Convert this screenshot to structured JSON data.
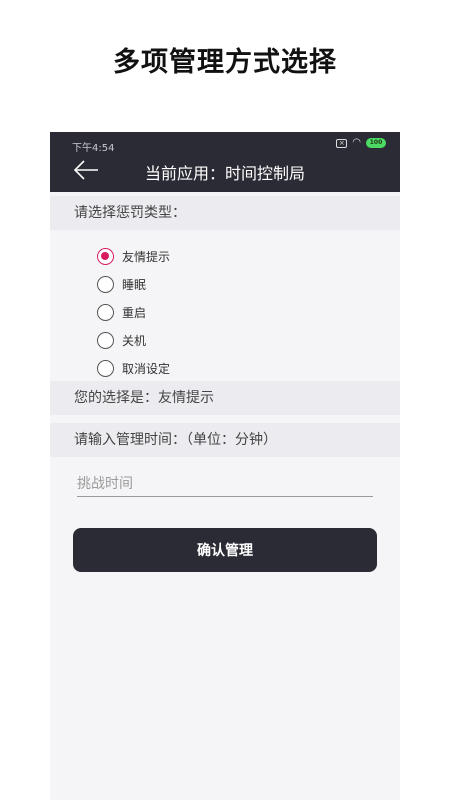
{
  "banner": {
    "title": "多项管理方式选择"
  },
  "status_bar": {
    "time": "下午4:54",
    "sim_icon": "sim-off-icon",
    "wifi_icon": "wifi-icon",
    "battery": "100"
  },
  "appbar": {
    "back_icon": "arrow-left-icon",
    "title": "当前应用：时间控制局"
  },
  "penalty": {
    "heading": "请选择惩罚类型：",
    "options": [
      {
        "label": "友情提示",
        "checked": true
      },
      {
        "label": "睡眠",
        "checked": false
      },
      {
        "label": "重启",
        "checked": false
      },
      {
        "label": "关机",
        "checked": false
      },
      {
        "label": "取消设定",
        "checked": false
      }
    ],
    "selection_text": "您的选择是：友情提示"
  },
  "time_input": {
    "heading": "请输入管理时间：（单位：分钟）",
    "placeholder": "挑战时间",
    "value": ""
  },
  "confirm_button": {
    "label": "确认管理"
  },
  "colors": {
    "appbar_bg": "#2b2b35",
    "accent": "#d81b60",
    "section_bg": "#ececf0",
    "page_bg": "#f5f5f7"
  }
}
